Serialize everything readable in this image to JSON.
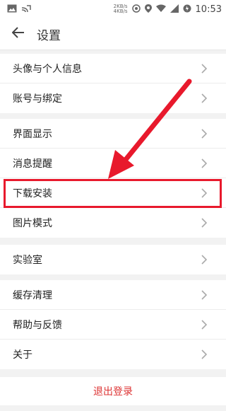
{
  "statusbar": {
    "netspeed_up": "2KB/s",
    "netspeed_down": "4KB/s",
    "time": "10:53"
  },
  "appbar": {
    "title": "设置"
  },
  "groups": [
    {
      "items": [
        "头像与个人信息",
        "账号与绑定"
      ]
    },
    {
      "items": [
        "界面显示",
        "消息提醒",
        "下载安装",
        "图片模式"
      ]
    },
    {
      "items": [
        "实验室"
      ]
    },
    {
      "items": [
        "缓存清理",
        "帮助与反馈",
        "关于"
      ]
    }
  ],
  "logout_label": "退出登录",
  "colors": {
    "highlight": "#e8192c",
    "logout_text": "#d33333"
  },
  "icons": [
    "image-icon",
    "cast-icon",
    "data-icon",
    "location-icon",
    "wifi-icon",
    "signal-icon",
    "battery-icon",
    "back-arrow-icon",
    "chevron-right-icon"
  ]
}
